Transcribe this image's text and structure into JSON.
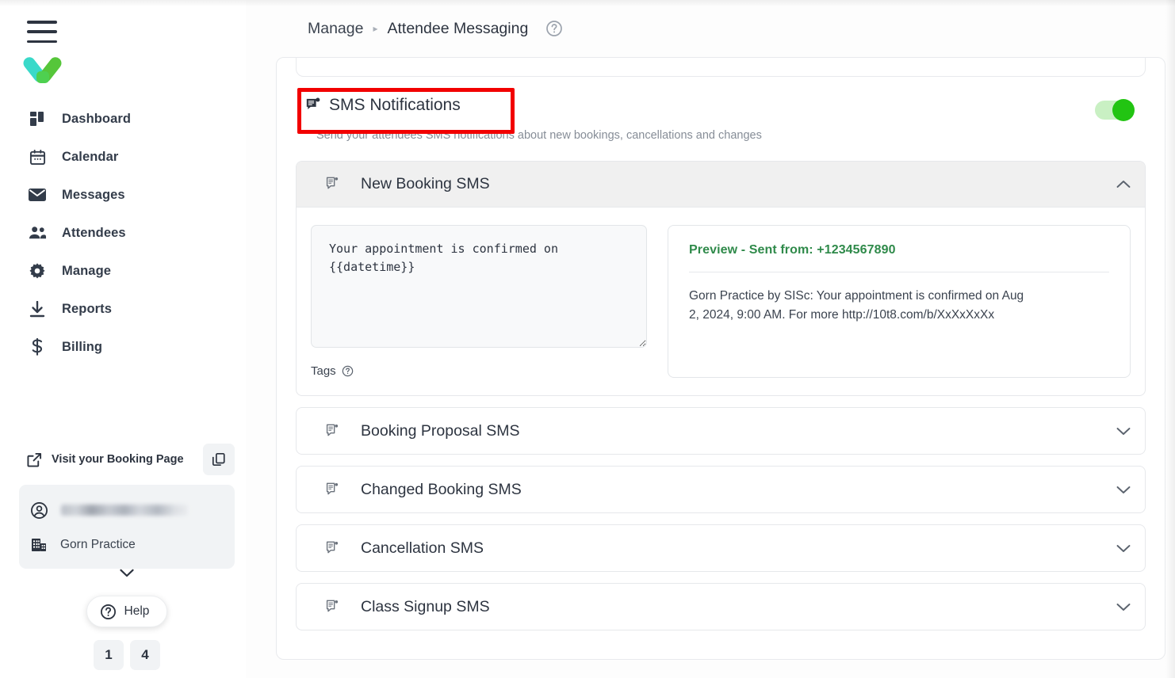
{
  "header": {
    "breadcrumb_parent": "Manage",
    "breadcrumb_separator": "▸",
    "breadcrumb_current": "Attendee Messaging",
    "help_icon": "question-circle-icon"
  },
  "sidebar": {
    "menu_icon": "hamburger-menu-icon",
    "logo_icon": "checkmark-logo-icon",
    "items": [
      {
        "label": "Dashboard",
        "icon": "dashboard-grid-icon"
      },
      {
        "label": "Calendar",
        "icon": "calendar-icon"
      },
      {
        "label": "Messages",
        "icon": "envelope-icon"
      },
      {
        "label": "Attendees",
        "icon": "people-icon"
      },
      {
        "label": "Manage",
        "icon": "gear-icon"
      },
      {
        "label": "Reports",
        "icon": "download-icon"
      },
      {
        "label": "Billing",
        "icon": "dollar-icon"
      }
    ],
    "booking_page": {
      "label": "Visit your Booking Page",
      "link_icon": "external-link-icon",
      "copy_icon": "copy-icon"
    },
    "account": {
      "user_icon": "user-circle-icon",
      "user_email": "",
      "org_icon": "building-icon",
      "org_name": "Gorn Practice",
      "expand_icon": "chevron-down-icon"
    },
    "help_button": {
      "label": "Help",
      "icon": "question-circle-icon"
    },
    "counters": [
      "1",
      "4"
    ]
  },
  "main": {
    "section": {
      "icon": "sms-notification-icon",
      "title": "SMS Notifications",
      "subtitle": "Send your attendees SMS notifications about new bookings, cancellations and changes",
      "toggle_on": true,
      "toggle_color": "#22c412",
      "highlight_color": "#f20000"
    },
    "accordions": [
      {
        "title": "New Booking SMS",
        "icon": "sms-notification-icon",
        "expanded": true,
        "chevron": "chevron-up-icon",
        "message_text": "Your appointment is confirmed on {{datetime}}",
        "tags_label": "Tags",
        "tags_help_icon": "question-circle-icon",
        "preview_title": "Preview - Sent from: +1234567890",
        "preview_body": "Gorn Practice by SISc: Your appointment is confirmed on Aug 2, 2024, 9:00 AM. For more http://10t8.com/b/XxXxXxXx",
        "preview_title_color": "#2f8a4a"
      },
      {
        "title": "Booking Proposal SMS",
        "icon": "sms-notification-icon",
        "expanded": false,
        "chevron": "chevron-down-icon"
      },
      {
        "title": "Changed Booking SMS",
        "icon": "sms-notification-icon",
        "expanded": false,
        "chevron": "chevron-down-icon"
      },
      {
        "title": "Cancellation SMS",
        "icon": "sms-notification-icon",
        "expanded": false,
        "chevron": "chevron-down-icon"
      },
      {
        "title": "Class Signup SMS",
        "icon": "sms-notification-icon",
        "expanded": false,
        "chevron": "chevron-down-icon"
      }
    ]
  }
}
